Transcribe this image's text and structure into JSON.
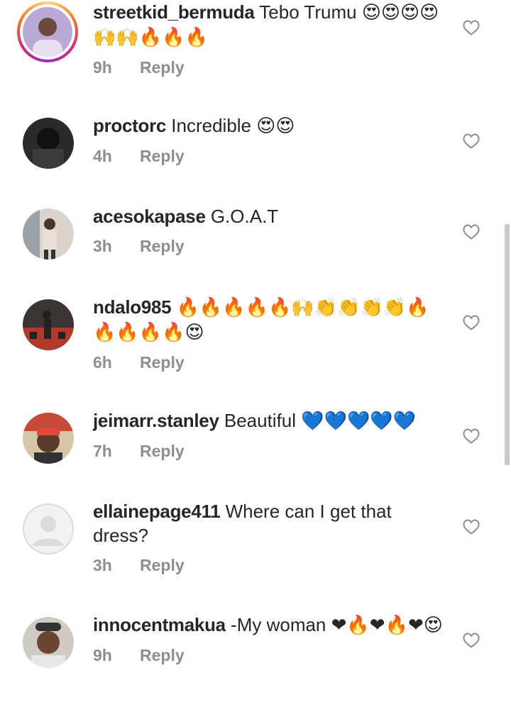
{
  "comments": [
    {
      "user": "streetkid_bermuda",
      "text": " Tebo Trumu ",
      "emoji": "😍😍😍😍🙌🙌🔥🔥🔥",
      "time": "9h",
      "reply": "Reply"
    },
    {
      "user": "proctorc",
      "text": " Incredible ",
      "emoji": "😍😍",
      "time": "4h",
      "reply": "Reply"
    },
    {
      "user": "acesokapase",
      "text": " G.O.A.T",
      "emoji": "",
      "time": "3h",
      "reply": "Reply"
    },
    {
      "user": "ndalo985",
      "text": " ",
      "emoji": "🔥🔥🔥🔥🔥🙌👏👏👏👏🔥🔥🔥🔥🔥😍",
      "time": "6h",
      "reply": "Reply"
    },
    {
      "user": "jeimarr.stanley",
      "text": " Beautiful ",
      "emoji": "💙💙💙💙💙",
      "time": "7h",
      "reply": "Reply"
    },
    {
      "user": "ellainepage411",
      "text": " Where can I get that dress?",
      "emoji": "",
      "time": "3h",
      "reply": "Reply"
    },
    {
      "user": "innocentmakua",
      "text": " -My woman ",
      "emoji": "❤🔥❤🔥❤😍",
      "time": "9h",
      "reply": "Reply"
    }
  ],
  "icons": {
    "like": "heart-outline-icon"
  },
  "colors": {
    "meta": "#8e8e8e",
    "text": "#262626",
    "ring_start": "#feda75",
    "ring_end": "#962fbf"
  }
}
